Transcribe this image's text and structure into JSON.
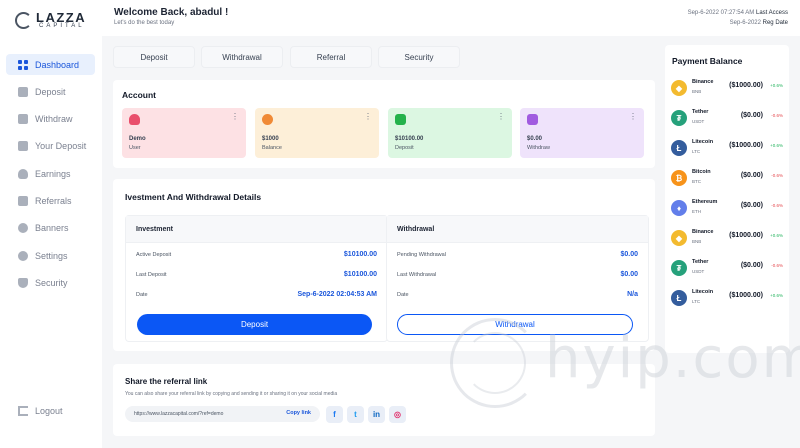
{
  "brand": {
    "name": "LAZZA",
    "tagline": "CAPITAL"
  },
  "header": {
    "welcome": "Welcome Back, abadul !",
    "subtitle": "Let's do the best today",
    "access_date": "Sep-6-2022 07:27:54 AM",
    "access_label": "Last Access",
    "reg_date": "Sep-6-2022",
    "reg_label": "Reg Date"
  },
  "sidebar": {
    "items": [
      {
        "label": "Dashboard",
        "icon": "grid-icon",
        "active": true
      },
      {
        "label": "Deposit",
        "icon": "deposit-icon"
      },
      {
        "label": "Withdraw",
        "icon": "wallet-icon"
      },
      {
        "label": "Your Deposit",
        "icon": "bank-icon"
      },
      {
        "label": "Earnings",
        "icon": "money-bag-icon"
      },
      {
        "label": "Referrals",
        "icon": "network-icon"
      },
      {
        "label": "Banners",
        "icon": "link-icon"
      },
      {
        "label": "Settings",
        "icon": "gear-icon"
      },
      {
        "label": "Security",
        "icon": "shield-icon"
      }
    ],
    "logout": "Logout"
  },
  "tabs": [
    "Deposit",
    "Withdrawal",
    "Referral",
    "Security"
  ],
  "account": {
    "title": "Account",
    "cards": [
      {
        "value": "Demo",
        "label": "User",
        "bg": "#fde1e4",
        "icon_color": "#e94e6b"
      },
      {
        "value": "$1000",
        "label": "Balance",
        "bg": "#fdefd8",
        "icon_color": "#f08a36"
      },
      {
        "value": "$10100.00",
        "label": "Deposit",
        "bg": "#dcf7e2",
        "icon_color": "#24b24b"
      },
      {
        "value": "$0.00",
        "label": "Withdraw",
        "bg": "#efe3fb",
        "icon_color": "#a15be0"
      }
    ]
  },
  "details": {
    "title": "Ivestment And Withdrawal Details",
    "investment": {
      "title": "Investment",
      "rows": [
        {
          "label": "Active Deposit",
          "value": "$10100.00"
        },
        {
          "label": "Last Deposit",
          "value": "$10100.00"
        },
        {
          "label": "Date",
          "value": "Sep-6-2022 02:04:53 AM"
        }
      ],
      "button": "Deposit"
    },
    "withdrawal": {
      "title": "Withdrawal",
      "rows": [
        {
          "label": "Pending Withdrawal",
          "value": "$0.00"
        },
        {
          "label": "Last Withdrawal",
          "value": "$0.00"
        },
        {
          "label": "Date",
          "value": "N/a"
        }
      ],
      "button": "Withdrawal"
    }
  },
  "referral": {
    "title": "Share the referral link",
    "desc": "You can also share your referral link by copying and sending it or sharing it on your social media",
    "url": "https://www.lazzacapital.com/?ref=demo",
    "copy": "Copy link",
    "social": [
      {
        "glyph": "f",
        "icon": "facebook-icon",
        "color": "#1877f2"
      },
      {
        "glyph": "t",
        "icon": "twitter-icon",
        "color": "#1d9bf0"
      },
      {
        "glyph": "in",
        "icon": "linkedin-icon",
        "color": "#0a66c2"
      },
      {
        "glyph": "◎",
        "icon": "instagram-icon",
        "color": "#e1306c"
      }
    ]
  },
  "payment": {
    "title": "Payment Balance",
    "coins": [
      {
        "name": "Binance",
        "sym": "BNB",
        "amount": "($1000.00)",
        "change": "+0.6%",
        "up": true,
        "color": "#f3ba2f",
        "glyph": "◆",
        "icon": "binance-icon"
      },
      {
        "name": "Tether",
        "sym": "USDT",
        "amount": "($0.00)",
        "change": "-0.6%",
        "up": false,
        "color": "#26a17b",
        "glyph": "₮",
        "icon": "tether-icon"
      },
      {
        "name": "Litecoin",
        "sym": "LTC",
        "amount": "($1000.00)",
        "change": "+0.6%",
        "up": true,
        "color": "#345d9d",
        "glyph": "Ł",
        "icon": "litecoin-icon"
      },
      {
        "name": "Bitcoin",
        "sym": "BTC",
        "amount": "($0.00)",
        "change": "-0.6%",
        "up": false,
        "color": "#f7931a",
        "glyph": "₿",
        "icon": "bitcoin-icon"
      },
      {
        "name": "Ethereum",
        "sym": "ETH",
        "amount": "($0.00)",
        "change": "-0.6%",
        "up": false,
        "color": "#627eea",
        "glyph": "♦",
        "icon": "ethereum-icon"
      },
      {
        "name": "Binance",
        "sym": "BNB",
        "amount": "($1000.00)",
        "change": "+0.6%",
        "up": true,
        "color": "#f3ba2f",
        "glyph": "◆",
        "icon": "binance-icon"
      },
      {
        "name": "Tether",
        "sym": "USDT",
        "amount": "($0.00)",
        "change": "-0.6%",
        "up": false,
        "color": "#26a17b",
        "glyph": "₮",
        "icon": "tether-icon"
      },
      {
        "name": "Litecoin",
        "sym": "LTC",
        "amount": "($1000.00)",
        "change": "+0.6%",
        "up": true,
        "color": "#345d9d",
        "glyph": "Ł",
        "icon": "litecoin-icon"
      }
    ]
  },
  "watermark": "hyip.com"
}
